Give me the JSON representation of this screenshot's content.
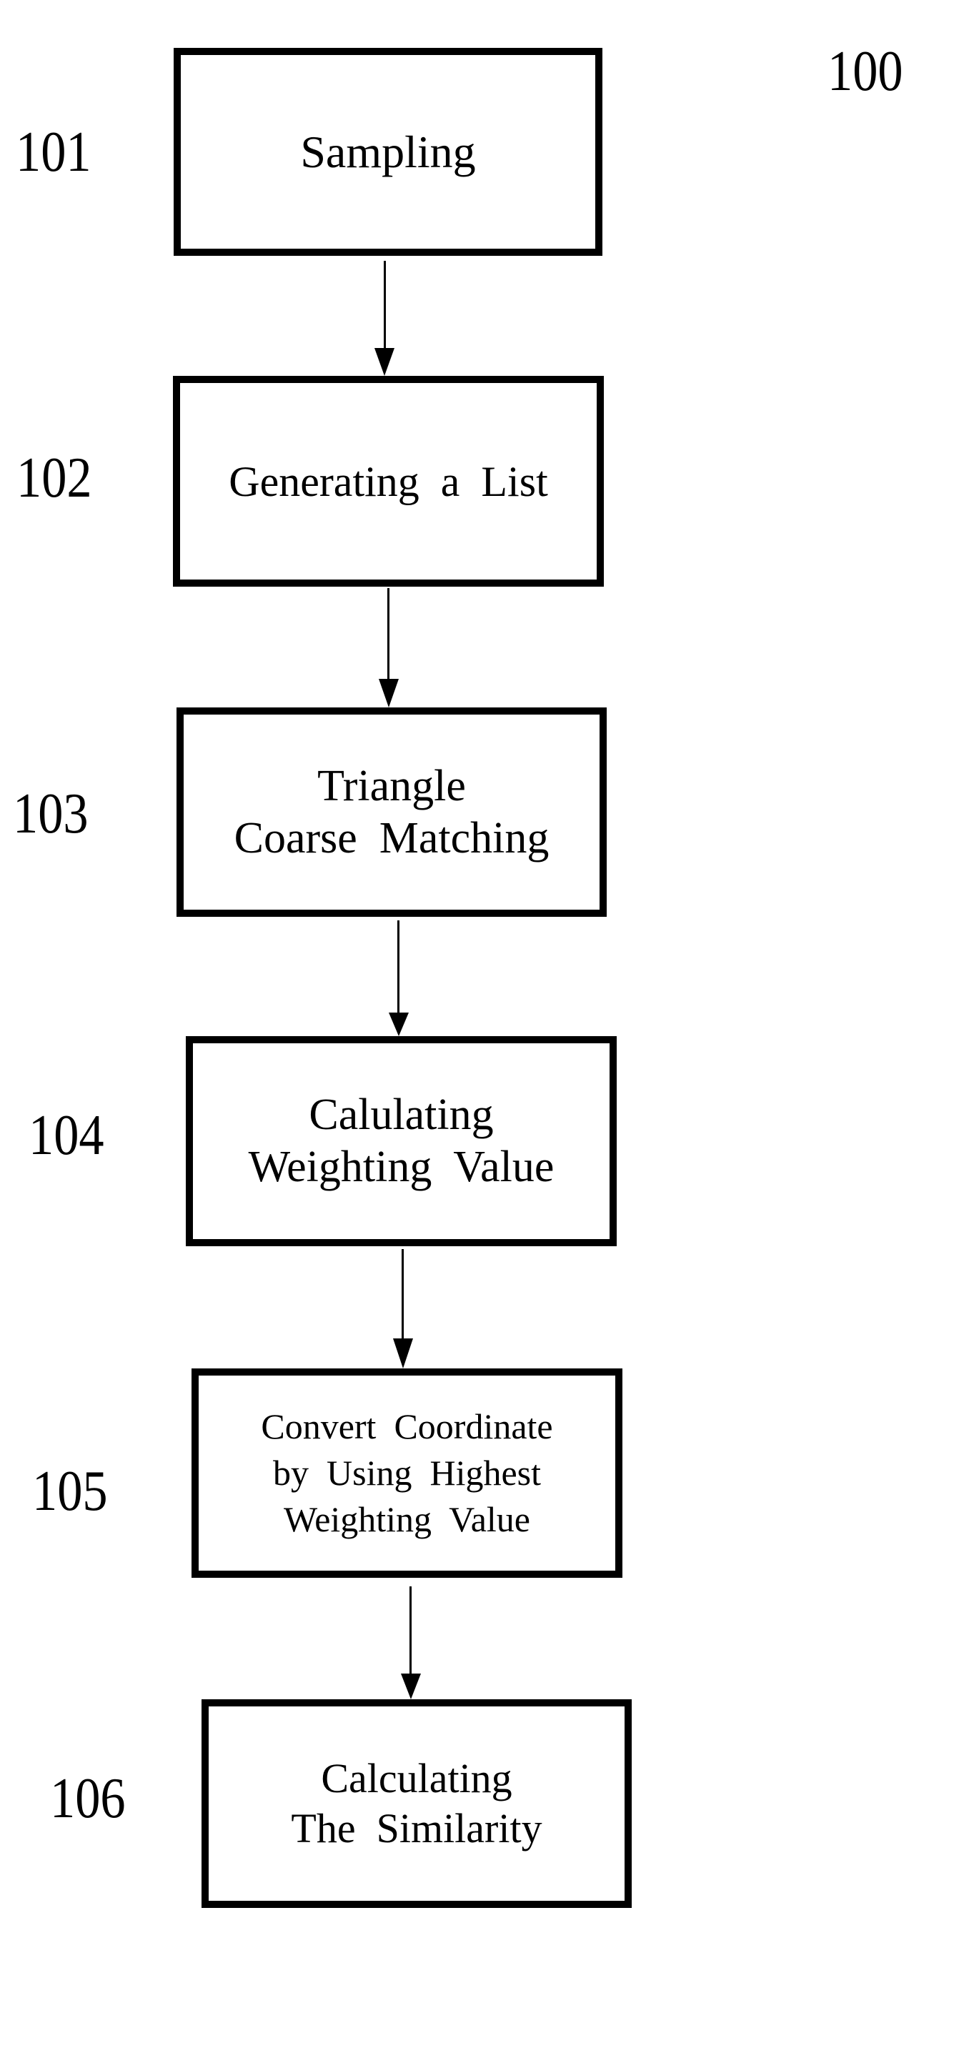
{
  "figure": {
    "reference_number": "100",
    "steps": [
      {
        "ref": "101",
        "lines": [
          "Sampling"
        ]
      },
      {
        "ref": "102",
        "lines": [
          "Generating a List"
        ]
      },
      {
        "ref": "103",
        "lines": [
          "Triangle",
          "Coarse Matching"
        ]
      },
      {
        "ref": "104",
        "lines": [
          "Calulating",
          "Weighting Value"
        ]
      },
      {
        "ref": "105",
        "lines": [
          "Convert Coordinate",
          "by Using Highest",
          "Weighting Value"
        ]
      },
      {
        "ref": "106",
        "lines": [
          "Calculating",
          "The Similarity"
        ]
      }
    ],
    "connections": [
      {
        "from": "101",
        "to": "102"
      },
      {
        "from": "102",
        "to": "103"
      },
      {
        "from": "103",
        "to": "104"
      },
      {
        "from": "104",
        "to": "105"
      },
      {
        "from": "105",
        "to": "106"
      }
    ]
  }
}
